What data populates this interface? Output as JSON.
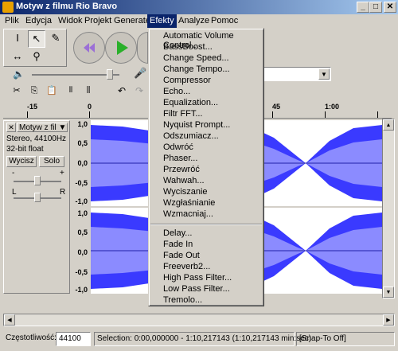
{
  "window": {
    "title": "Motyw z filmu Rio Bravo",
    "minimize_label": "_",
    "maximize_label": "□",
    "close_label": "✕"
  },
  "menubar": {
    "items": [
      "Plik",
      "Edycja",
      "Widok",
      "Projekt",
      "Generate",
      "Efekty",
      "Analyze",
      "Pomoc"
    ],
    "active": "Efekty"
  },
  "toolbar": {
    "tools": [
      "selection-tool",
      "envelope-tool",
      "draw-tool",
      "zoom-tool",
      "timeshift-tool",
      "multi-tool"
    ],
    "volume_icon": "speaker-icon",
    "mic_icon": "microphone-icon"
  },
  "ruler": {
    "labels": [
      "-15",
      "0",
      "45",
      "1:00"
    ]
  },
  "track": {
    "name": "Motyw z fil",
    "info_rate": "Stereo, 44100Hz",
    "info_format": "32-bit float",
    "mute_label": "Wycisz",
    "solo_label": "Solo",
    "gain_minus": "-",
    "gain_plus": "+",
    "pan_left": "L",
    "pan_right": "R",
    "scale_top": [
      "1,0",
      "0,5",
      "0,0",
      "-0,5",
      "-1,0"
    ],
    "scale_bottom": [
      "1,0",
      "0,5",
      "0,0",
      "-0,5",
      "-1,0"
    ],
    "wave_color": "#3a3aff",
    "wave_bg": "#ffffff"
  },
  "effects_menu": {
    "group1": [
      "Automatic Volume Control...",
      "BassBoost...",
      "Change Speed...",
      "Change Tempo...",
      "Compressor",
      "Echo...",
      "Equalization...",
      "Filtr FFT...",
      "Nyquist Prompt...",
      "Odszumiacz...",
      "Odwróć",
      "Phaser...",
      "Przewróć",
      "Wahwah...",
      "Wyciszanie",
      "Wzgłaśnianie",
      "Wzmacniaj..."
    ],
    "group2": [
      "Delay...",
      "Fade In",
      "Fade Out",
      "Freeverb2...",
      "High Pass Filter...",
      "Low Pass Filter...",
      "Tremolo..."
    ]
  },
  "statusbar": {
    "rate_label": "Częstotliwość:",
    "rate_value": "44100",
    "selection": "Selection: 0:00,000000 - 1:10,217143 (1:10,217143 min:sec)",
    "snap": "[Snap-To Off]"
  }
}
